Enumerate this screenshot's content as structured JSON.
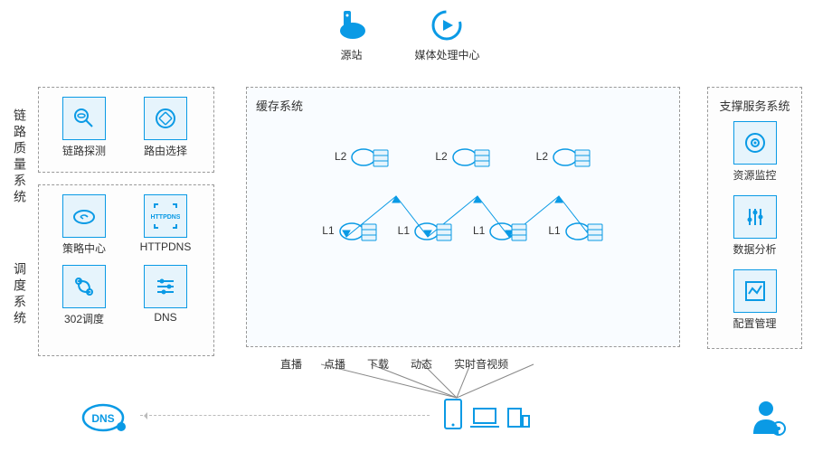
{
  "top": {
    "origin": "源站",
    "media_center": "媒体处理中心"
  },
  "left": {
    "link_quality": {
      "title": "链路质量系统",
      "items": [
        {
          "label": "链路探测",
          "icon": "probe"
        },
        {
          "label": "路由选择",
          "icon": "route"
        }
      ]
    },
    "scheduling": {
      "title": "调度系统",
      "items": [
        {
          "label": "策略中心",
          "icon": "policy"
        },
        {
          "label": "HTTPDNS",
          "icon": "httpdns"
        },
        {
          "label": "302调度",
          "icon": "302"
        },
        {
          "label": "DNS",
          "icon": "dns"
        }
      ]
    }
  },
  "center": {
    "title": "缓存系统",
    "l2": [
      "L2",
      "L2",
      "L2"
    ],
    "l1": [
      "L1",
      "L1",
      "L1",
      "L1"
    ]
  },
  "right": {
    "title": "支撑服务系统",
    "items": [
      {
        "label": "资源监控",
        "icon": "monitor"
      },
      {
        "label": "数据分析",
        "icon": "analytics"
      },
      {
        "label": "配置管理",
        "icon": "config"
      }
    ]
  },
  "services": [
    "直播",
    "点播",
    "下载",
    "动态",
    "实时音视频"
  ],
  "bottom": {
    "dns_label": "DNS"
  }
}
